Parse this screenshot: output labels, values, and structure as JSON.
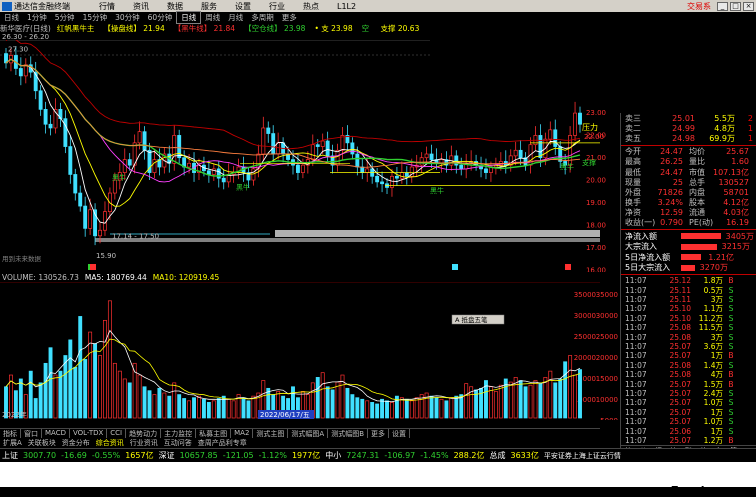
{
  "app": {
    "title": "通达信金融终端",
    "menus": [
      "行情",
      "资讯",
      "数据",
      "服务",
      "设置",
      "行业",
      "热点",
      "L1L2"
    ],
    "logo": "交易系"
  },
  "periods": [
    "日线",
    "1分钟",
    "5分钟",
    "15分钟",
    "30分钟",
    "60分钟",
    "日线",
    "周线",
    "月线",
    "多周期",
    "更多"
  ],
  "active_period_index": 6,
  "titleline": {
    "stock": "新华医疗(日线)",
    "formula": "红帆黑牛主",
    "items": [
      {
        "label": "【操盘线】",
        "value": "21.94",
        "color": "#ffff00"
      },
      {
        "label": "【黑牛线】",
        "value": "21.84",
        "color": "#ff3030"
      },
      {
        "label": "【空仓线】",
        "value": "23.98",
        "color": "#30d030"
      },
      {
        "label": "• 支",
        "value": "23.98",
        "color": "#ffff00"
      },
      {
        "label": "空",
        "value": "",
        "color": "#30d030"
      },
      {
        "label": "支撑",
        "value": "20.63",
        "color": "#ffff00"
      }
    ]
  },
  "subtitle": "26.30 - 26.20",
  "price_axis": [
    "23.00",
    "22.00",
    "21.00",
    "20.00",
    "19.00",
    "18.00",
    "17.00",
    "16.00"
  ],
  "chart_labels": {
    "high": "27.30",
    "low": "17.14 - 17.50",
    "low2": "15.90",
    "zhangli": "压力",
    "zhicheng": "支撑",
    "buy": "买",
    "curprice": "22.00",
    "hint": "均线",
    "hint2": "买点",
    "heiniu": "黑牛"
  },
  "volume_header": {
    "volume": "VOLUME: 130526.73",
    "ma5": "MA5: 180769.44",
    "ma10": "MA10: 120919.45"
  },
  "vol_axis": [
    "35000",
    "30000",
    "25000",
    "20000",
    "15000",
    "10000"
  ],
  "vol_axis2": [
    "35000",
    "30000",
    "25000",
    "20000",
    "15000",
    "10000",
    "5000"
  ],
  "tooltip": "A 抵盘五笔",
  "date_label": "2022/06/17/五",
  "year_label": "2022年",
  "panel": {
    "asks": [
      {
        "label": "卖三",
        "price": "25.01",
        "vol": "5.5万",
        "chg": "2"
      },
      {
        "label": "卖二",
        "price": "24.99",
        "vol": "4.8万",
        "chg": "1"
      },
      {
        "label": "卖五",
        "price": "24.98",
        "vol": "69.9万",
        "chg": "1"
      }
    ],
    "quotes": [
      {
        "label": "今开",
        "v1": "24.47",
        "l2": "均价",
        "v2": "25.67"
      },
      {
        "label": "最高",
        "v1": "26.25",
        "l2": "量比",
        "v2": "1.60"
      },
      {
        "label": "最低",
        "v1": "24.47",
        "l2": "市值",
        "v2": "107.13亿"
      },
      {
        "label": "现量",
        "v1": "25",
        "l2": "总手",
        "v2": "130527"
      },
      {
        "label": "外盘",
        "v1": "71826",
        "l2": "内盘",
        "v2": "58701"
      },
      {
        "label": "换手",
        "v1": "3.24%",
        "l2": "股本",
        "v2": "4.12亿"
      },
      {
        "label": "净资",
        "v1": "12.59",
        "l2": "流通",
        "v2": "4.03亿"
      },
      {
        "label": "收益(一)",
        "v1": "0.790",
        "l2": "PE(动)",
        "v2": "16.19"
      }
    ],
    "flows": [
      {
        "label": "净流入额",
        "value": "3405万",
        "w": 40
      },
      {
        "label": "大宗流入",
        "value": "3215万",
        "w": 36
      },
      {
        "label": "5日净流入额",
        "value": "1.21亿",
        "w": 20
      },
      {
        "label": "5日大宗流入",
        "value": "3270万",
        "w": 14
      }
    ],
    "ticks": [
      {
        "t": "11:07",
        "p": "25.12",
        "v": "1.8万",
        "d": "B"
      },
      {
        "t": "11:07",
        "p": "25.11",
        "v": "0.5万",
        "d": "S"
      },
      {
        "t": "11:07",
        "p": "25.11",
        "v": "3万",
        "d": "S"
      },
      {
        "t": "11:07",
        "p": "25.10",
        "v": "1.1万",
        "d": "S"
      },
      {
        "t": "11:07",
        "p": "25.10",
        "v": "11.2万",
        "d": "S"
      },
      {
        "t": "11:07",
        "p": "25.08",
        "v": "11.5万",
        "d": "S"
      },
      {
        "t": "11:07",
        "p": "25.08",
        "v": "3万",
        "d": "S"
      },
      {
        "t": "11:07",
        "p": "25.07",
        "v": "3.6万",
        "d": "S"
      },
      {
        "t": "11:07",
        "p": "25.07",
        "v": "1万",
        "d": "B"
      },
      {
        "t": "11:07",
        "p": "25.08",
        "v": "1.4万",
        "d": "S"
      },
      {
        "t": "11:07",
        "p": "25.08",
        "v": "4万",
        "d": "B"
      },
      {
        "t": "11:07",
        "p": "25.07",
        "v": "1.5万",
        "d": "B"
      },
      {
        "t": "11:07",
        "p": "25.07",
        "v": "2.4万",
        "d": "S"
      },
      {
        "t": "11:07",
        "p": "25.07",
        "v": "1.0万",
        "d": "S"
      },
      {
        "t": "11:07",
        "p": "25.07",
        "v": "1万",
        "d": "S"
      },
      {
        "t": "11:07",
        "p": "25.07",
        "v": "1.0万",
        "d": "S"
      },
      {
        "t": "11:07",
        "p": "25.06",
        "v": "1万",
        "d": "S"
      },
      {
        "t": "11:07",
        "p": "25.07",
        "v": "1.2万",
        "d": "B"
      }
    ],
    "detail_tabs": [
      "笔",
      "价",
      "细",
      "势",
      "联",
      "值",
      "主",
      "筹"
    ]
  },
  "bottom_tabs": [
    "指标",
    "窗口",
    "MACD",
    "VOL-TDX",
    "CCI",
    "趋势动力",
    "主力监控",
    "私募主图",
    "MA2",
    "测式主图",
    "测式幅图A",
    "测式幅图B",
    "更多",
    "设置"
  ],
  "bottom_tabs2": [
    "扩展A",
    "关联板块",
    "资金分布",
    "综合资讯",
    "行业资讯",
    "互动问答",
    "查周产品利专章"
  ],
  "status": {
    "sh_label": "上证",
    "sh_val": "3007.70",
    "sh_chg": "-16.69",
    "sh_pct": "-0.55%",
    "sh_amt": "1657亿",
    "sz_label": "深证",
    "sz_val": "10657.85",
    "sz_chg": "-121.05",
    "sz_pct": "-1.12%",
    "sz_amt": "1977亿",
    "zx_label": "中小",
    "zx_val": "7247.31",
    "zx_chg": "-106.97",
    "zx_pct": "-1.45%",
    "zx_amt": "288.2亿",
    "cy_label": "总成",
    "cy_val": "3633亿",
    "broker": "平安证券上海上证云行情"
  },
  "watermark": "www.7gpzb.com",
  "colors": {
    "up": "#ff3030",
    "down": "#40e0ff",
    "ma5": "#ffffff",
    "ma10": "#ffff00",
    "ma20": "#ff40ff"
  }
}
